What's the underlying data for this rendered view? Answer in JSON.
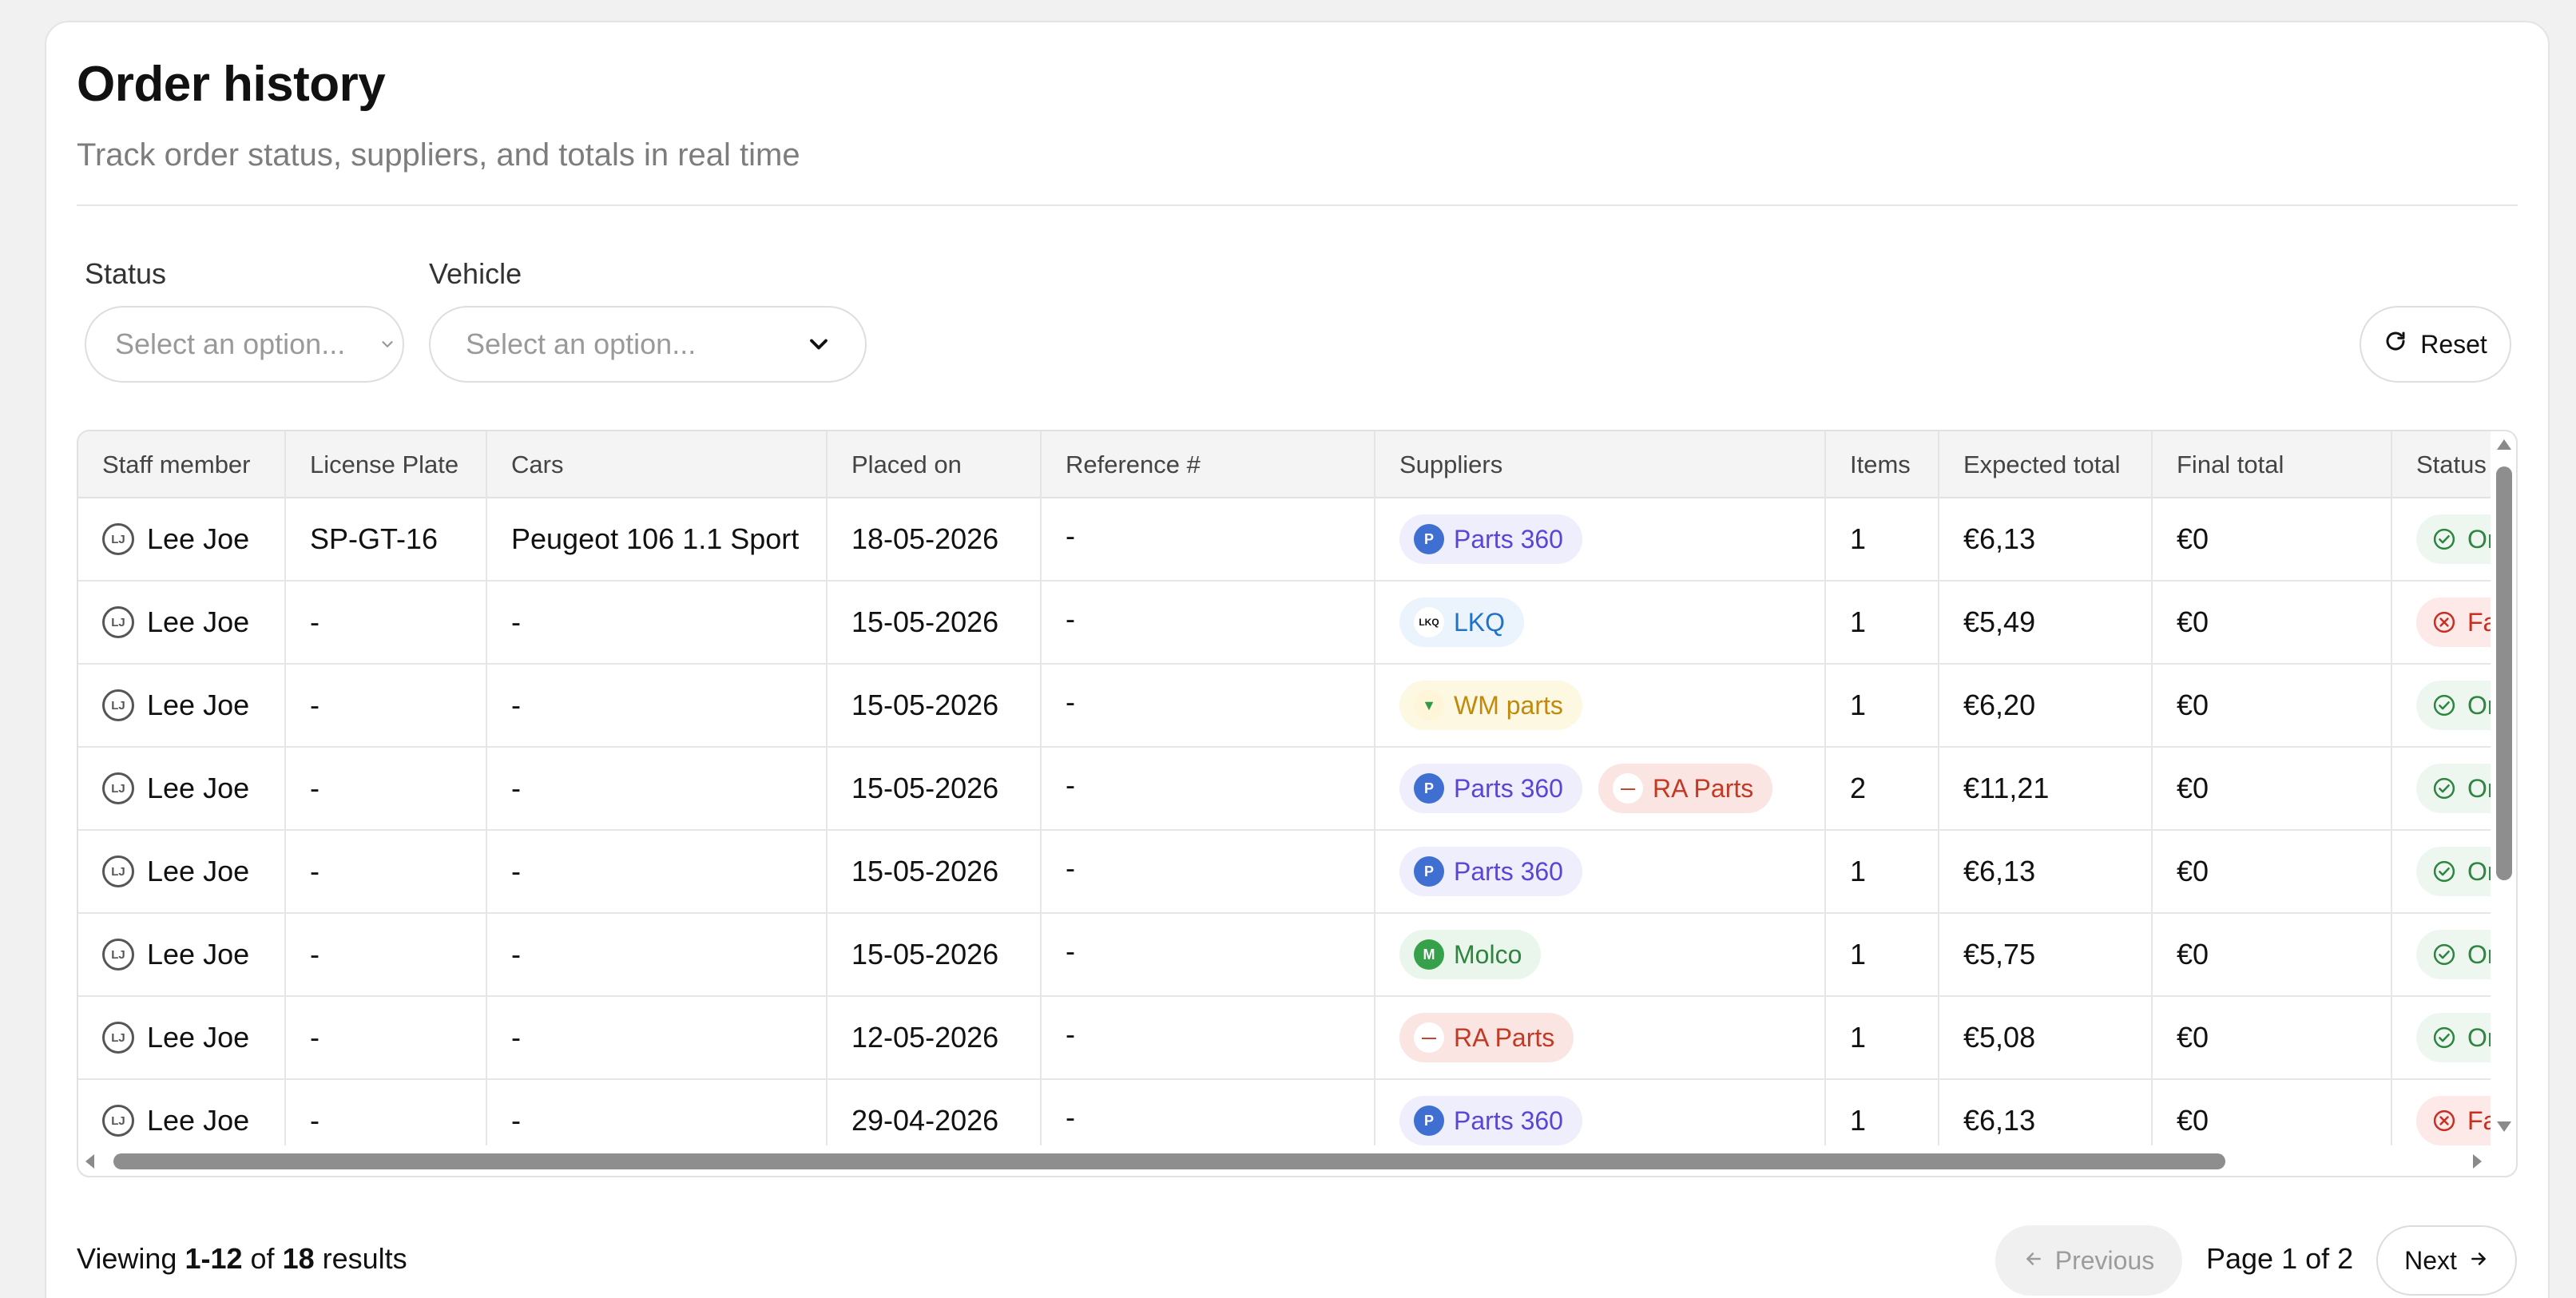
{
  "header": {
    "title": "Order history",
    "subtitle": "Track order status, suppliers, and totals in real time"
  },
  "filters": {
    "status_label": "Status",
    "status_placeholder": "Select an option...",
    "vehicle_label": "Vehicle",
    "vehicle_placeholder": "Select an option...",
    "reset_label": "Reset"
  },
  "table": {
    "columns": [
      "Staff member",
      "License Plate",
      "Cars",
      "Placed on",
      "Reference #",
      "Suppliers",
      "Items",
      "Expected total",
      "Final total",
      "Status"
    ],
    "rows": [
      {
        "staff": "Lee Joe",
        "initials": "LJ",
        "plate": "SP-GT-16",
        "car": "Peugeot 106 1.1 Sport",
        "placed": "18-05-2026",
        "ref": "-",
        "suppliers": [
          "Parts 360"
        ],
        "items": "1",
        "expected": "€6,13",
        "final": "€0",
        "status": "Ordered"
      },
      {
        "staff": "Lee Joe",
        "initials": "LJ",
        "plate": "-",
        "car": "-",
        "placed": "15-05-2026",
        "ref": "-",
        "suppliers": [
          "LKQ"
        ],
        "items": "1",
        "expected": "€5,49",
        "final": "€0",
        "status": "Failed"
      },
      {
        "staff": "Lee Joe",
        "initials": "LJ",
        "plate": "-",
        "car": "-",
        "placed": "15-05-2026",
        "ref": "-",
        "suppliers": [
          "WM parts"
        ],
        "items": "1",
        "expected": "€6,20",
        "final": "€0",
        "status": "Ordered"
      },
      {
        "staff": "Lee Joe",
        "initials": "LJ",
        "plate": "-",
        "car": "-",
        "placed": "15-05-2026",
        "ref": "-",
        "suppliers": [
          "Parts 360",
          "RA Parts"
        ],
        "items": "2",
        "expected": "€11,21",
        "final": "€0",
        "status": "Ordered"
      },
      {
        "staff": "Lee Joe",
        "initials": "LJ",
        "plate": "-",
        "car": "-",
        "placed": "15-05-2026",
        "ref": "-",
        "suppliers": [
          "Parts 360"
        ],
        "items": "1",
        "expected": "€6,13",
        "final": "€0",
        "status": "Ordered"
      },
      {
        "staff": "Lee Joe",
        "initials": "LJ",
        "plate": "-",
        "car": "-",
        "placed": "15-05-2026",
        "ref": "-",
        "suppliers": [
          "Molco"
        ],
        "items": "1",
        "expected": "€5,75",
        "final": "€0",
        "status": "Ordered"
      },
      {
        "staff": "Lee Joe",
        "initials": "LJ",
        "plate": "-",
        "car": "-",
        "placed": "12-05-2026",
        "ref": "-",
        "suppliers": [
          "RA Parts"
        ],
        "items": "1",
        "expected": "€5,08",
        "final": "€0",
        "status": "Ordered"
      },
      {
        "staff": "Lee Joe",
        "initials": "LJ",
        "plate": "-",
        "car": "-",
        "placed": "29-04-2026",
        "ref": "-",
        "suppliers": [
          "Parts 360"
        ],
        "items": "1",
        "expected": "€6,13",
        "final": "€0",
        "status": "Failed"
      }
    ]
  },
  "supplier_styles": {
    "Parts 360": {
      "bg": "#eeeefc",
      "fg": "#5a45d6",
      "logo_bg": "#3f6fd1",
      "logo_text": "P",
      "logo_fg": "#ffffff",
      "icon": "parts-360-logo-icon"
    },
    "LKQ": {
      "bg": "#ebf3fc",
      "fg": "#1f73c9",
      "logo_bg": "#ffffff",
      "logo_text": "LKQ",
      "logo_fg": "#111111",
      "icon": "lkq-logo-icon"
    },
    "WM parts": {
      "bg": "#fdf8e2",
      "fg": "#c08a0c",
      "logo_bg": "#fff6d9",
      "logo_text": "▼",
      "logo_fg": "#2f9a4a",
      "icon": "wm-parts-logo-icon"
    },
    "RA Parts": {
      "bg": "#fbe5e2",
      "fg": "#c23a25",
      "logo_bg": "#ffffff",
      "logo_text": "—",
      "logo_fg": "#c23a25",
      "icon": "ra-parts-logo-icon"
    },
    "Molco": {
      "bg": "#eaf6ec",
      "fg": "#2e8540",
      "logo_bg": "#36a14a",
      "logo_text": "M",
      "logo_fg": "#ffffff",
      "icon": "molco-logo-icon"
    }
  },
  "pagination": {
    "viewing_prefix": "Viewing",
    "range": "1-12",
    "of_word": "of",
    "total": "18",
    "results_word": "results",
    "previous_label": "Previous",
    "page_indicator": "Page 1 of 2",
    "next_label": "Next"
  },
  "colors": {
    "ordered": "#2e8540",
    "failed": "#c62f22"
  }
}
